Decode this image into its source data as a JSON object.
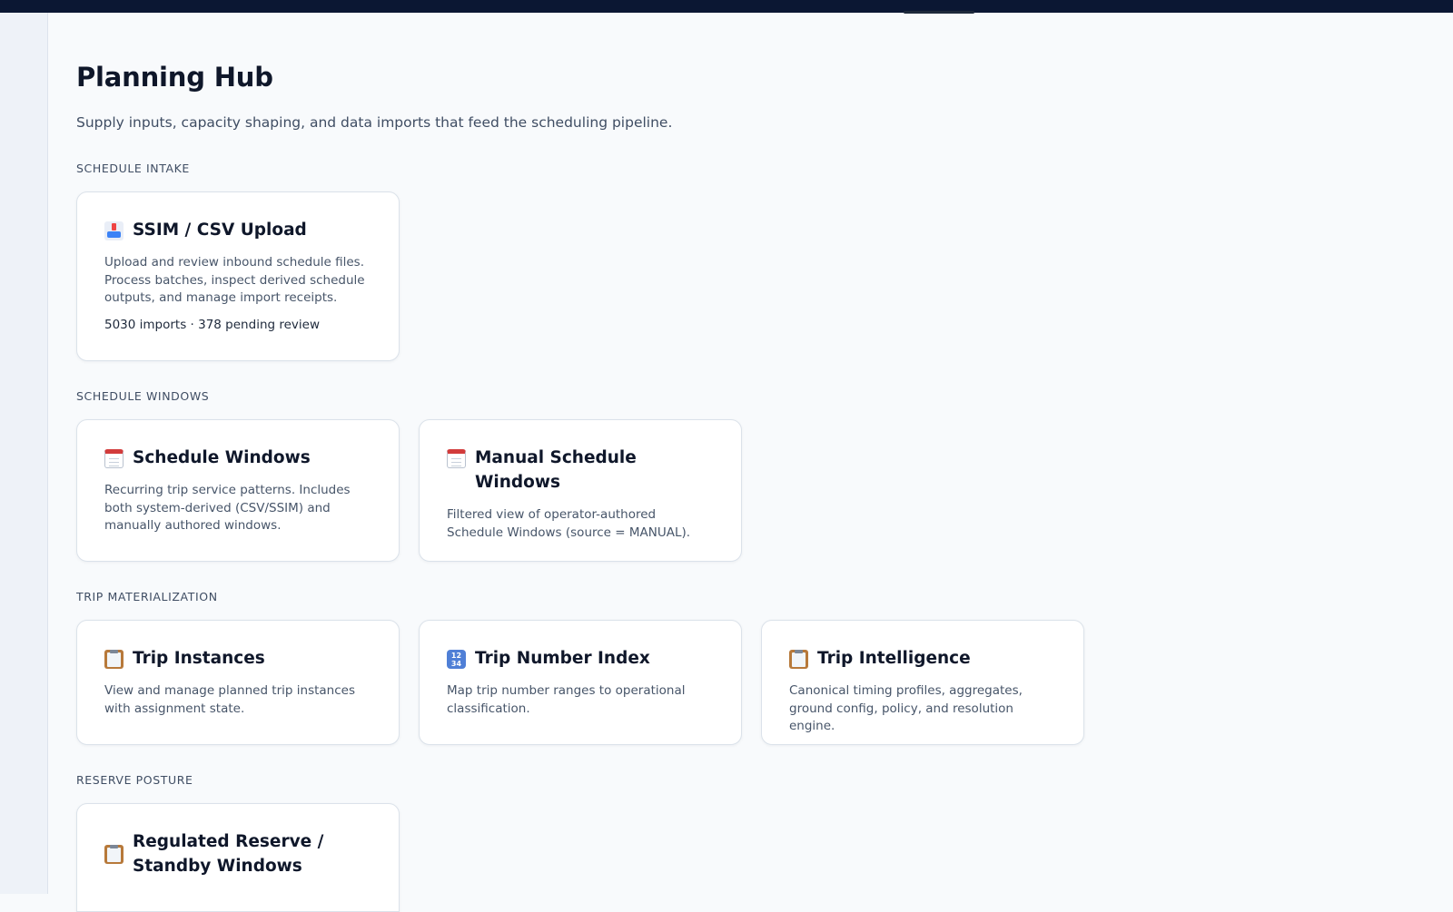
{
  "page": {
    "title": "Planning Hub",
    "subtitle": "Supply inputs, capacity shaping, and data imports that feed the scheduling pipeline."
  },
  "sections": [
    {
      "label": "SCHEDULE INTAKE",
      "cards": [
        {
          "icon": "inbox-tray-icon",
          "title": "SSIM / CSV Upload",
          "description": "Upload and review inbound schedule files. Process batches, inspect derived schedule outputs, and manage import receipts.",
          "meta": "5030 imports · 378 pending review"
        }
      ]
    },
    {
      "label": "SCHEDULE WINDOWS",
      "cards": [
        {
          "icon": "calendar-icon",
          "title": "Schedule Windows",
          "description": "Recurring trip service patterns. Includes both system-derived (CSV/SSIM) and manually authored windows."
        },
        {
          "icon": "calendar-icon",
          "title": "Manual Schedule Windows",
          "description": "Filtered view of operator-authored Schedule Windows (source = MANUAL)."
        }
      ]
    },
    {
      "label": "TRIP MATERIALIZATION",
      "cards": [
        {
          "icon": "clipboard-icon",
          "title": "Trip Instances",
          "description": "View and manage planned trip instances with assignment state."
        },
        {
          "icon": "numbers-icon",
          "title": "Trip Number Index",
          "description": "Map trip number ranges to operational classification."
        },
        {
          "icon": "clipboard-icon",
          "title": "Trip Intelligence",
          "description": "Canonical timing profiles, aggregates, ground config, policy, and resolution engine."
        }
      ]
    },
    {
      "label": "RESERVE POSTURE",
      "cards": [
        {
          "icon": "clipboard-icon",
          "title": "Regulated Reserve / Standby Windows",
          "description": ""
        }
      ]
    }
  ],
  "numbers_icon_text": [
    "12",
    "34"
  ]
}
